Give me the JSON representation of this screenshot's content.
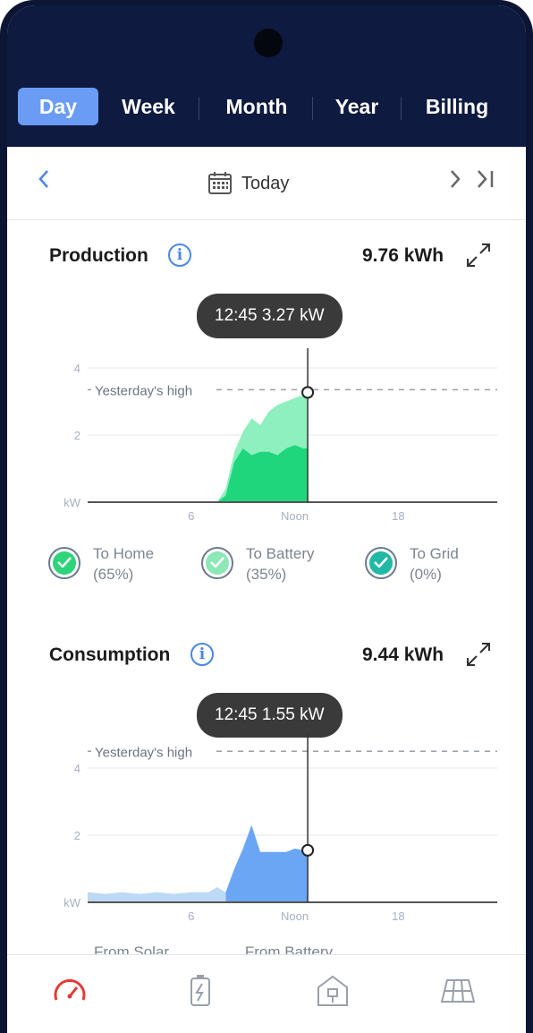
{
  "tabs": [
    {
      "label": "Day",
      "active": true
    },
    {
      "label": "Week",
      "active": false
    },
    {
      "label": "Month",
      "active": false
    },
    {
      "label": "Year",
      "active": false
    },
    {
      "label": "Billing",
      "active": false
    }
  ],
  "date_bar": {
    "label": "Today"
  },
  "production": {
    "title": "Production",
    "total": "9.76 kWh",
    "tooltip": "12:45 3.27 kW",
    "yesterday_label": "Yesterday's high",
    "legend": [
      {
        "label": "To Home",
        "pct": "(65%)",
        "color": "#2ed47a"
      },
      {
        "label": "To Battery",
        "pct": "(35%)",
        "color": "#8ce9b6"
      },
      {
        "label": "To Grid",
        "pct": "(0%)",
        "color": "#21b8a5"
      }
    ]
  },
  "consumption": {
    "title": "Consumption",
    "total": "9.44 kWh",
    "tooltip": "12:45 1.55 kW",
    "yesterday_label": "Yesterday's high",
    "legend_peek": [
      "From Solar",
      "From Battery"
    ]
  },
  "axis": {
    "y_ticks": [
      "4",
      "2",
      "kW"
    ],
    "x_ticks": [
      "6",
      "Noon",
      "18"
    ]
  },
  "chart_data": [
    {
      "type": "area",
      "title": "Production",
      "x_unit": "hour",
      "ylim": [
        0,
        4
      ],
      "yesterday_high": 3.35,
      "series": [
        {
          "name": "To Battery",
          "x": [
            7.5,
            8,
            8.5,
            9,
            9.5,
            10,
            10.5,
            11,
            11.5,
            12,
            12.5,
            12.75
          ],
          "values": [
            0,
            0.4,
            1.5,
            2.1,
            2.5,
            2.3,
            2.7,
            2.9,
            3.0,
            3.1,
            3.2,
            3.27
          ]
        },
        {
          "name": "To Home",
          "x": [
            7.5,
            8,
            8.5,
            9,
            9.5,
            10,
            10.5,
            11,
            11.5,
            12,
            12.5,
            12.75
          ],
          "values": [
            0,
            0.2,
            1.2,
            1.6,
            1.4,
            1.5,
            1.5,
            1.4,
            1.6,
            1.7,
            1.6,
            1.6
          ]
        }
      ]
    },
    {
      "type": "area",
      "title": "Consumption",
      "x_unit": "hour",
      "ylim": [
        0,
        4
      ],
      "yesterday_high": 4.5,
      "series": [
        {
          "name": "From Solar",
          "x": [
            8,
            8.5,
            9,
            9.5,
            10,
            10.5,
            11,
            11.5,
            12,
            12.5,
            12.75
          ],
          "values": [
            0.3,
            1.0,
            1.6,
            2.3,
            1.5,
            1.5,
            1.5,
            1.5,
            1.6,
            1.55,
            1.55
          ]
        },
        {
          "name": "From Battery",
          "x": [
            0,
            1,
            2,
            3,
            4,
            5,
            6,
            7,
            7.5,
            8
          ],
          "values": [
            0.3,
            0.25,
            0.3,
            0.25,
            0.3,
            0.25,
            0.3,
            0.3,
            0.45,
            0.3
          ]
        }
      ]
    }
  ]
}
